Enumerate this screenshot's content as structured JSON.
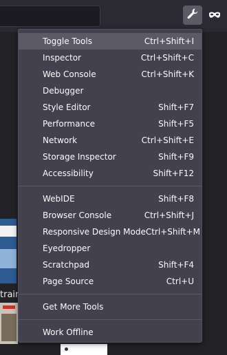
{
  "toolbar": {
    "tools_icon": "wrench-icon",
    "private_icon": "private-mask-icon"
  },
  "background": {
    "partial_text": "trainir"
  },
  "menu": {
    "groups": [
      [
        {
          "label": "Toggle Tools",
          "shortcut": "Ctrl+Shift+I"
        },
        {
          "label": "Inspector",
          "shortcut": "Ctrl+Shift+C"
        },
        {
          "label": "Web Console",
          "shortcut": "Ctrl+Shift+K"
        },
        {
          "label": "Debugger",
          "shortcut": ""
        },
        {
          "label": "Style Editor",
          "shortcut": "Shift+F7"
        },
        {
          "label": "Performance",
          "shortcut": "Shift+F5"
        },
        {
          "label": "Network",
          "shortcut": "Ctrl+Shift+E"
        },
        {
          "label": "Storage Inspector",
          "shortcut": "Shift+F9"
        },
        {
          "label": "Accessibility",
          "shortcut": "Shift+F12"
        }
      ],
      [
        {
          "label": "WebIDE",
          "shortcut": "Shift+F8"
        },
        {
          "label": "Browser Console",
          "shortcut": "Ctrl+Shift+J"
        },
        {
          "label": "Responsive Design Mode",
          "shortcut": "Ctrl+Shift+M"
        },
        {
          "label": "Eyedropper",
          "shortcut": ""
        },
        {
          "label": "Scratchpad",
          "shortcut": "Shift+F4"
        },
        {
          "label": "Page Source",
          "shortcut": "Ctrl+U"
        }
      ],
      [
        {
          "label": "Get More Tools",
          "shortcut": ""
        }
      ],
      [
        {
          "label": "Work Offline",
          "shortcut": ""
        }
      ]
    ]
  }
}
